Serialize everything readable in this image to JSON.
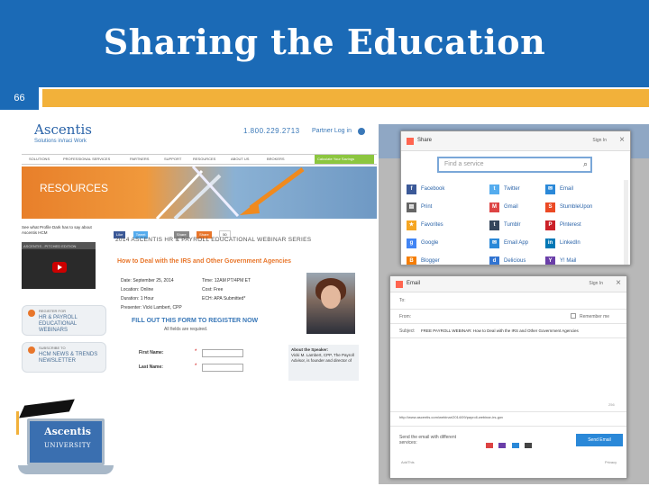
{
  "slide": {
    "title": "Sharing the Education",
    "page_number": "66",
    "colors": {
      "header": "#1b6ab6",
      "gold": "#f2b13a",
      "orange": "#e8762b"
    }
  },
  "site": {
    "logo": "Ascentis",
    "tagline": "Solutions in/raci Work",
    "phone": "1.800.229.2713",
    "partner_login": "Partner Log in",
    "nav": [
      "SOLUTIONS",
      "PROFESSIONAL SERVICES",
      "PARTNERS",
      "SUPPORT",
      "RESOURCES",
      "ABOUT US",
      "BROKERS"
    ],
    "calculate": "Calculate Your Savings",
    "hero": "RESOURCES",
    "side_text": "See what Profile Dark has to say about Ascentis HCM",
    "video_label": "ASCENTIS - PITCHED EDITION",
    "promo1_small": "REGISTER FOR",
    "promo1_big": "HR & PAYROLL EDUCATIONAL WEBINARS",
    "promo2_small": "SUBSCRIBE TO",
    "promo2_big": "HCM NEWS & TRENDS NEWSLETTER",
    "share_buttons": [
      "Like",
      "Tweet",
      "Share",
      "Share",
      "50"
    ],
    "webinar_series": "2014 ASCENTIS HR & PAYROLL EDUCATIONAL WEBINAR SERIES",
    "event_title": "How to Deal with the IRS and Other Government Agencies",
    "details": {
      "date_lbl": "Date:",
      "date": "September 25, 2014",
      "location_lbl": "Location:",
      "location": "Online",
      "duration_lbl": "Duration:",
      "duration": "1 Hour",
      "presenter_lbl": "Presenter:",
      "presenter": "Vicki Lambert, CPP",
      "time_lbl": "Time:",
      "time": "12AM PT/4PM ET",
      "cost_lbl": "Cost:",
      "cost": "Free",
      "ech_lbl": "ECH:",
      "ech": "APA Submitted*"
    },
    "register": "FILL OUT THIS FORM TO REGISTER NOW",
    "required": "All fields are required.",
    "first_name": "First Name:",
    "last_name": "Last Name:",
    "speaker_title": "About the Speaker:",
    "speaker_text": "Vicki M. Lambert, CPP, The Payroll Advisor, is founder and director of"
  },
  "share": {
    "title": "Share",
    "signin": "Sign In",
    "search_placeholder": "Find a service",
    "services": [
      [
        "Facebook",
        "Twitter",
        "Email"
      ],
      [
        "Print",
        "Gmail",
        "StumbleUpon"
      ],
      [
        "Favorites",
        "Tumblr",
        "Pinterest"
      ],
      [
        "Google",
        "Email App",
        "LinkedIn"
      ],
      [
        "Blogger",
        "Delicious",
        "Y! Mail"
      ]
    ]
  },
  "email": {
    "title": "Email",
    "signin": "Sign In",
    "to": "To:",
    "from": "From:",
    "remember": "Remember me",
    "subject_lbl": "Subject",
    "subject": "FREE PAYROLL WEBINAR: How to Deal with the IRS and Other Government Agencies",
    "count": "256",
    "url": "http://www.ascentis.com/webinar/2014/09/payroll-webinar-irs-gov",
    "send_via": "Send the email with different services:",
    "send_button": "Send Email",
    "addthis": "AddThis",
    "privacy": "Privacy"
  },
  "university": {
    "name": "Ascentis",
    "sub": "UNIVERSITY"
  }
}
